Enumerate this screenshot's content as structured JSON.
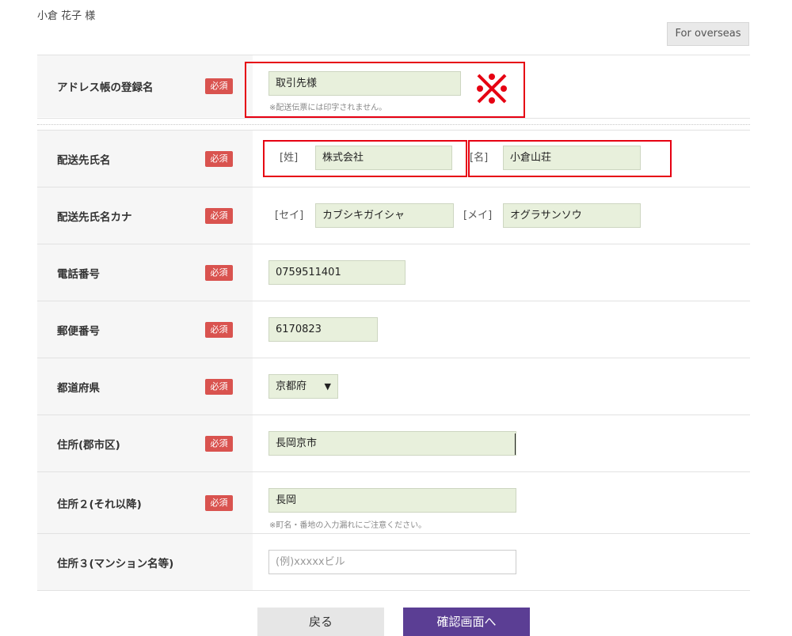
{
  "header": {
    "user_name": "小倉 花子 様",
    "overseas_label": "For overseas"
  },
  "fields": {
    "address_book_name": {
      "label": "アドレス帳の登録名",
      "required": "必須",
      "value": "取引先様",
      "note": "※配送伝票には印字されません。",
      "annotation": "※"
    },
    "recipient_name": {
      "label": "配送先氏名",
      "required": "必須",
      "last_prefix": "[姓]",
      "last_value": "株式会社",
      "first_prefix": "[名]",
      "first_value": "小倉山荘"
    },
    "recipient_kana": {
      "label": "配送先氏名カナ",
      "required": "必須",
      "last_prefix": "[セイ]",
      "last_value": "カブシキガイシャ",
      "first_prefix": "[メイ]",
      "first_value": "オグラサンソウ"
    },
    "phone": {
      "label": "電話番号",
      "required": "必須",
      "value": "0759511401"
    },
    "postal_code": {
      "label": "郵便番号",
      "required": "必須",
      "value": "6170823"
    },
    "prefecture": {
      "label": "都道府県",
      "required": "必須",
      "value": "京都府"
    },
    "address1": {
      "label": "住所(郡市区)",
      "required": "必須",
      "value": "長岡京市"
    },
    "address2": {
      "label": "住所２(それ以降)",
      "required": "必須",
      "value": "長岡",
      "note": "※町名・番地の入力漏れにご注意ください。"
    },
    "address3": {
      "label": "住所３(マンション名等)",
      "placeholder": "(例)xxxxxビル"
    }
  },
  "buttons": {
    "back": "戻る",
    "confirm": "確認画面へ"
  },
  "colors": {
    "required_badge": "#d9534f",
    "filled_input": "#e8f0dc",
    "highlight": "#e60012",
    "confirm_button": "#5b3e94"
  }
}
